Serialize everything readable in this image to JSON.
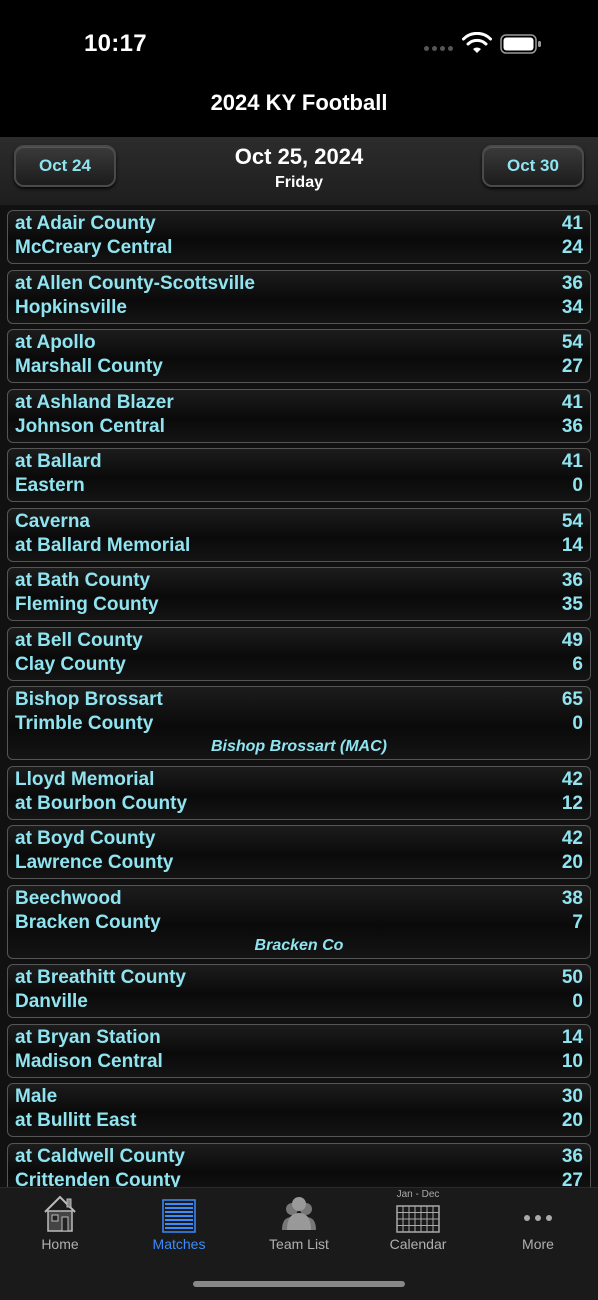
{
  "status_bar": {
    "time": "10:17"
  },
  "nav": {
    "title": "2024 KY Football"
  },
  "date_header": {
    "prev_label": "Oct 24",
    "next_label": "Oct 30",
    "date": "Oct 25, 2024",
    "weekday": "Friday"
  },
  "games": [
    {
      "team1": "at Adair County",
      "score1": "41",
      "team2": "McCreary Central",
      "score2": "24",
      "site": ""
    },
    {
      "team1": "at Allen County-Scottsville",
      "score1": "36",
      "team2": "Hopkinsville",
      "score2": "34",
      "site": ""
    },
    {
      "team1": "at Apollo",
      "score1": "54",
      "team2": "Marshall County",
      "score2": "27",
      "site": ""
    },
    {
      "team1": "at Ashland Blazer",
      "score1": "41",
      "team2": "Johnson Central",
      "score2": "36",
      "site": ""
    },
    {
      "team1": "at Ballard",
      "score1": "41",
      "team2": "Eastern",
      "score2": "0",
      "site": ""
    },
    {
      "team1": "Caverna",
      "score1": "54",
      "team2": "at Ballard Memorial",
      "score2": "14",
      "site": ""
    },
    {
      "team1": "at Bath County",
      "score1": "36",
      "team2": "Fleming County",
      "score2": "35",
      "site": ""
    },
    {
      "team1": "at Bell County",
      "score1": "49",
      "team2": "Clay County",
      "score2": "6",
      "site": ""
    },
    {
      "team1": "Bishop Brossart",
      "score1": "65",
      "team2": "Trimble County",
      "score2": "0",
      "site": "Bishop Brossart (MAC)"
    },
    {
      "team1": "Lloyd Memorial",
      "score1": "42",
      "team2": "at Bourbon County",
      "score2": "12",
      "site": ""
    },
    {
      "team1": "at Boyd County",
      "score1": "42",
      "team2": "Lawrence County",
      "score2": "20",
      "site": ""
    },
    {
      "team1": "Beechwood",
      "score1": "38",
      "team2": "Bracken County",
      "score2": "7",
      "site": "Bracken Co"
    },
    {
      "team1": "at Breathitt County",
      "score1": "50",
      "team2": "Danville",
      "score2": "0",
      "site": ""
    },
    {
      "team1": "at Bryan Station",
      "score1": "14",
      "team2": "Madison Central",
      "score2": "10",
      "site": ""
    },
    {
      "team1": "Male",
      "score1": "30",
      "team2": "at Bullitt East",
      "score2": "20",
      "site": ""
    },
    {
      "team1": "at Caldwell County",
      "score1": "36",
      "team2": "Crittenden County",
      "score2": "27",
      "site": ""
    }
  ],
  "tab_bar": {
    "tabs": [
      {
        "label": "Home",
        "icon": "house-icon",
        "active": false
      },
      {
        "label": "Matches",
        "icon": "list-icon",
        "active": true
      },
      {
        "label": "Team List",
        "icon": "people-icon",
        "active": false
      },
      {
        "label": "Calendar",
        "icon": "calendar-icon",
        "active": false,
        "caption": "Jan - Dec"
      },
      {
        "label": "More",
        "icon": "more-icon",
        "active": false
      }
    ]
  },
  "colors": {
    "accent_text": "#8fe4f0",
    "active_tab": "#3b8cff",
    "background": "#000000"
  }
}
